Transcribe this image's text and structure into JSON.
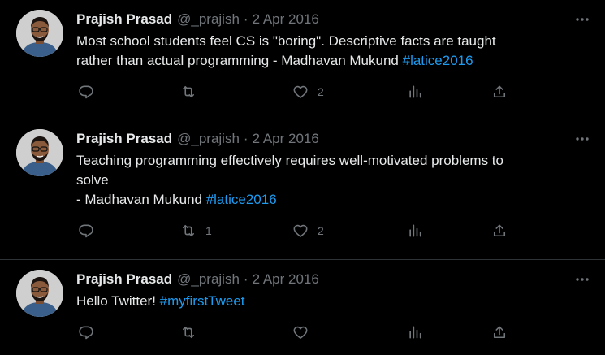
{
  "tweets": [
    {
      "name": "Prajish Prasad",
      "handle": "@_prajish",
      "separator": "·",
      "date": "2 Apr 2016",
      "text_lines": [
        "Most school students feel CS is \"boring\". Descriptive facts are taught",
        "rather than actual programming - Madhavan Mukund "
      ],
      "hashtag": "#latice2016",
      "reply_count": "",
      "retweet_count": "",
      "like_count": "2"
    },
    {
      "name": "Prajish Prasad",
      "handle": "@_prajish",
      "separator": "·",
      "date": "2 Apr 2016",
      "text_lines": [
        "Teaching programming effectively requires well-motivated problems to",
        "solve",
        "- Madhavan Mukund "
      ],
      "hashtag": "#latice2016",
      "reply_count": "",
      "retweet_count": "1",
      "like_count": "2"
    },
    {
      "name": "Prajish Prasad",
      "handle": "@_prajish",
      "separator": "·",
      "date": "2 Apr 2016",
      "text_lines": [
        "Hello Twitter! "
      ],
      "hashtag": "#myfirstTweet",
      "reply_count": "",
      "retweet_count": "",
      "like_count": ""
    }
  ],
  "icons": {
    "reply": "reply-icon",
    "retweet": "retweet-icon",
    "like": "heart-icon",
    "views": "views-icon",
    "share": "share-icon",
    "more": "more-icon"
  },
  "colors": {
    "background": "#000000",
    "text": "#e7e9ea",
    "muted": "#71767b",
    "link": "#1d9bf0",
    "divider": "#2f3336"
  }
}
